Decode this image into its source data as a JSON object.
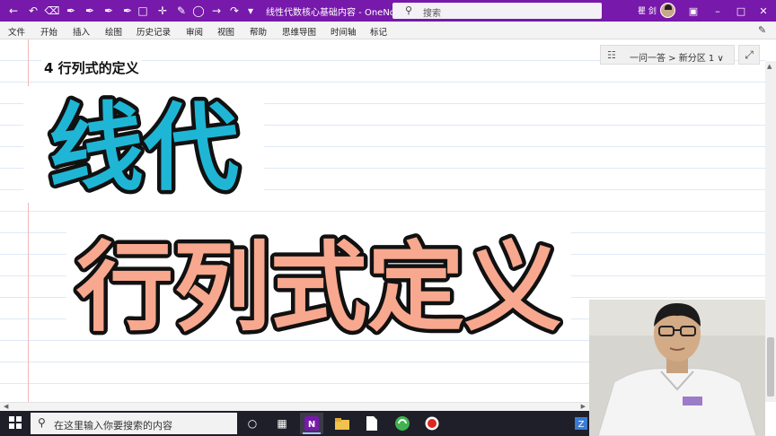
{
  "app": {
    "window_title": "线性代数核心基础内容 - OneNote",
    "search_placeholder": "搜索",
    "user_name": "瞿 剑"
  },
  "menu": {
    "tabs": [
      "文件",
      "开始",
      "插入",
      "绘图",
      "历史记录",
      "审阅",
      "视图",
      "帮助",
      "思维导图",
      "时间轴",
      "标记"
    ]
  },
  "page": {
    "heading": "4 行列式的定义",
    "breadcrumb": "一问一答 > 新分区 1",
    "big_text_line1": "线代",
    "big_text_line2": "行列式定义"
  },
  "taskbar": {
    "search_placeholder": "在这里输入你要搜索的内容"
  },
  "colors": {
    "title_bar": "#7719aa",
    "line1_fill": "#1fb6d6",
    "line2_fill": "#f7a88e",
    "text_stroke": "#111111"
  },
  "icons": [
    "back-icon",
    "undo-icon",
    "eraser-icon",
    "pen-icon",
    "lasso-icon",
    "search-icon",
    "notebook-icon",
    "expand-icon"
  ]
}
